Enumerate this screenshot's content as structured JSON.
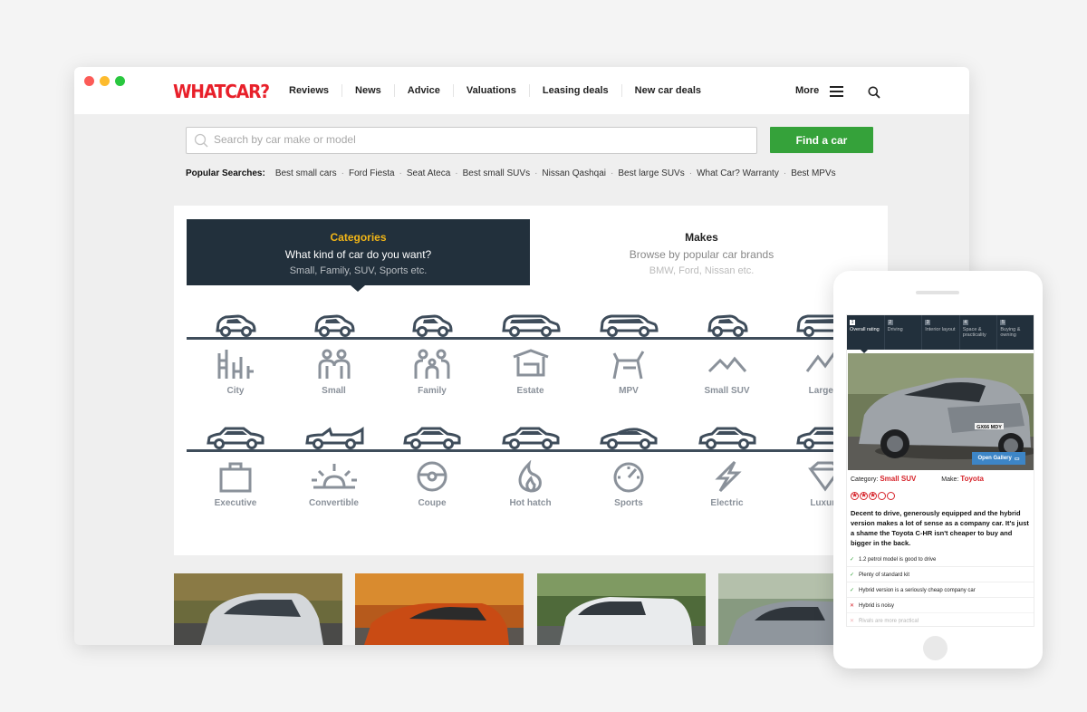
{
  "desktop": {
    "logo": "WHATCAR?",
    "nav": [
      "Reviews",
      "News",
      "Advice",
      "Valuations",
      "Leasing deals",
      "New car deals"
    ],
    "more_label": "More",
    "search": {
      "placeholder": "Search by car make or model",
      "button": "Find a car"
    },
    "popular": {
      "label": "Popular Searches",
      "items": [
        "Best small cars",
        "Ford Fiesta",
        "Seat Ateca",
        "Best small SUVs",
        "Nissan Qashqai",
        "Best large SUVs",
        "What Car? Warranty",
        "Best MPVs"
      ]
    },
    "tabs": {
      "categories": {
        "title": "Categories",
        "subtitle": "What kind of car do you want?",
        "hint": "Small, Family, SUV, Sports etc."
      },
      "makes": {
        "title": "Makes",
        "subtitle": "Browse by popular car brands",
        "hint": "BMW, Ford, Nissan etc."
      }
    },
    "categories_row1": [
      "City",
      "Small",
      "Family",
      "Estate",
      "MPV",
      "Small SUV",
      "Large S"
    ],
    "categories_row2": [
      "Executive",
      "Convertible",
      "Coupe",
      "Hot hatch",
      "Sports",
      "Electric",
      "Luxury"
    ]
  },
  "mobile": {
    "review_tabs": [
      {
        "num": "1",
        "label": "Overall rating"
      },
      {
        "num": "2",
        "label": "Driving"
      },
      {
        "num": "3",
        "label": "Interior layout"
      },
      {
        "num": "4",
        "label": "Space & practicality"
      },
      {
        "num": "5",
        "label": "Buying & owning"
      }
    ],
    "plate": "GX66 MDY",
    "gallery_button": "Open Gallery",
    "category_label": "Category:",
    "category_value": "Small SUV",
    "make_label": "Make:",
    "make_value": "Toyota",
    "rating": 3,
    "rating_max": 5,
    "verdict": "Decent to drive, generously equipped and the hybrid version makes a lot of sense as a company car. It's just a shame the Toyota C-HR isn't cheaper to buy and bigger in the back.",
    "pros": [
      "1.2 petrol model is good to drive",
      "Plenty of standard kit",
      "Hybrid version is a seriously cheap company car"
    ],
    "cons": [
      "Hybrid is noisy",
      "Rivals are more practical"
    ]
  },
  "colors": {
    "brand_red": "#e8202a",
    "nav_dark": "#22303c",
    "accent_yellow": "#f1b517",
    "green_button": "#35a23a",
    "icon_grey": "#8a919a"
  }
}
